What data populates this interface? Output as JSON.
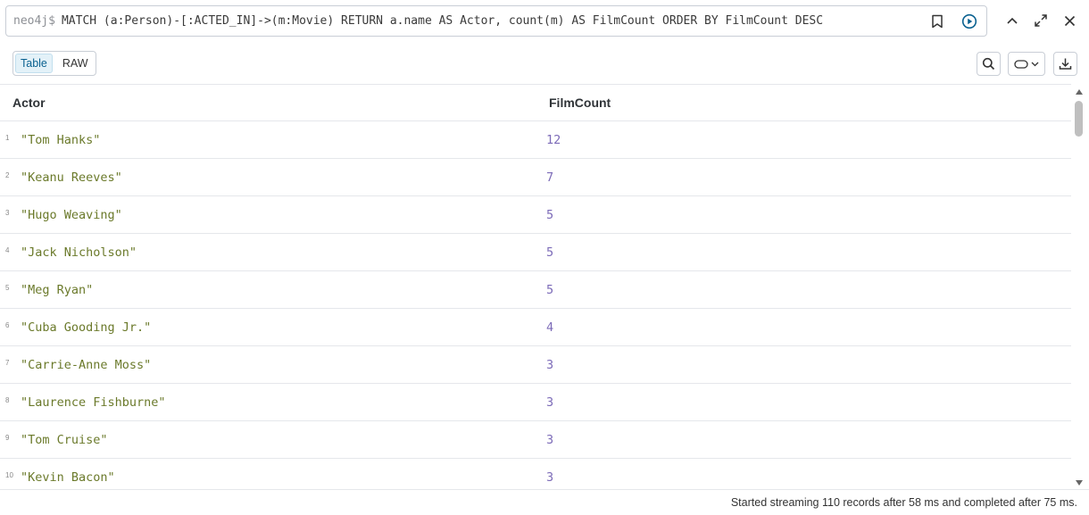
{
  "query": {
    "prompt": "neo4j$",
    "text": "MATCH (a:Person)-[:ACTED_IN]->(m:Movie) RETURN a.name AS Actor, count(m) AS FilmCount ORDER BY FilmCount DESC"
  },
  "toolbar": {
    "table_label": "Table",
    "raw_label": "RAW"
  },
  "table": {
    "columns": [
      "Actor",
      "FilmCount"
    ],
    "rows": [
      {
        "index": "1",
        "actor": "\"Tom Hanks\"",
        "count": "12"
      },
      {
        "index": "2",
        "actor": "\"Keanu Reeves\"",
        "count": "7"
      },
      {
        "index": "3",
        "actor": "\"Hugo Weaving\"",
        "count": "5"
      },
      {
        "index": "4",
        "actor": "\"Jack Nicholson\"",
        "count": "5"
      },
      {
        "index": "5",
        "actor": "\"Meg Ryan\"",
        "count": "5"
      },
      {
        "index": "6",
        "actor": "\"Cuba Gooding Jr.\"",
        "count": "4"
      },
      {
        "index": "7",
        "actor": "\"Carrie-Anne Moss\"",
        "count": "3"
      },
      {
        "index": "8",
        "actor": "\"Laurence Fishburne\"",
        "count": "3"
      },
      {
        "index": "9",
        "actor": "\"Tom Cruise\"",
        "count": "3"
      },
      {
        "index": "10",
        "actor": "\"Kevin Bacon\"",
        "count": "3"
      }
    ]
  },
  "status": "Started streaming 110 records after 58 ms and completed after 75 ms.",
  "colors": {
    "string_value": "#6b7a2b",
    "number_value": "#7c6bb8",
    "accent": "#0a6190"
  },
  "icons": [
    "bookmark-icon",
    "run-icon",
    "collapse-icon",
    "fullscreen-icon",
    "close-icon",
    "search-icon",
    "toggle-shape-icon",
    "chevron-down-icon",
    "download-icon"
  ]
}
